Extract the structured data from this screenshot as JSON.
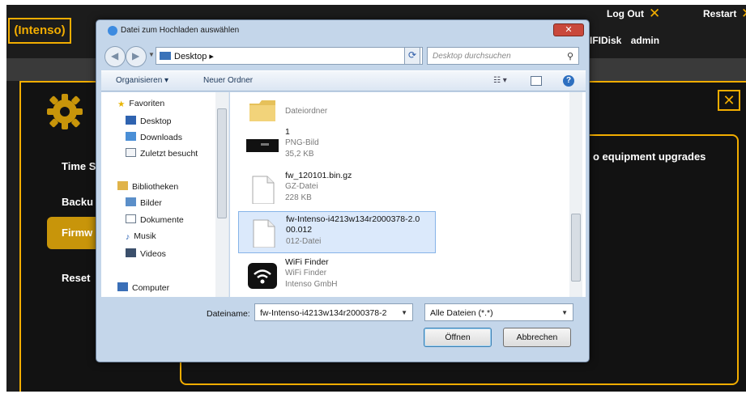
{
  "app": {
    "logo": "(Intenso)",
    "logout": "Log Out",
    "restart": "Restart",
    "device": "IFIDisk",
    "user": "admin",
    "menu": [
      "Time S",
      "Backu",
      "Firmw",
      "Reset"
    ],
    "content_text": "o equipment upgrades",
    "accent_color": "#f2ad00"
  },
  "dialog": {
    "title": "Datei zum Hochladen auswählen",
    "close_glyph": "✕",
    "address": "Desktop",
    "address_arrow": "▸",
    "search_placeholder": "Desktop durchsuchen",
    "toolbar": {
      "organize": "Organisieren ▾",
      "new_folder": "Neuer Ordner",
      "view_glyph": "☷ ▾",
      "help_glyph": "?"
    },
    "nav_items": [
      {
        "label": "Favoriten",
        "icon": "star-icon"
      },
      {
        "label": "Desktop",
        "icon": "desktop-icon"
      },
      {
        "label": "Downloads",
        "icon": "downloads-icon"
      },
      {
        "label": "Zuletzt besucht",
        "icon": "recent-icon"
      },
      {
        "label": "Bibliotheken",
        "icon": "library-icon"
      },
      {
        "label": "Bilder",
        "icon": "pictures-icon"
      },
      {
        "label": "Dokumente",
        "icon": "documents-icon"
      },
      {
        "label": "Musik",
        "icon": "music-icon"
      },
      {
        "label": "Videos",
        "icon": "videos-icon"
      },
      {
        "label": "Computer",
        "icon": "computer-icon"
      }
    ],
    "files": [
      {
        "name": "",
        "type": "Dateiordner",
        "size": ""
      },
      {
        "name": "1",
        "type": "PNG-Bild",
        "size": "35,2 KB"
      },
      {
        "name": "fw_120101.bin.gz",
        "type": "GZ-Datei",
        "size": "228 KB"
      },
      {
        "name": "fw-Intenso-i4213w134r2000378-2.0",
        "name2": "00.012",
        "type": "012-Datei",
        "size": ""
      },
      {
        "name": "WiFi Finder",
        "type": "WiFi Finder",
        "size": "Intenso GmbH"
      }
    ],
    "filename_label": "Dateiname:",
    "filename_value": "fw-Intenso-i4213w134r2000378-2",
    "filetype_value": "Alle Dateien (*.*)",
    "open_button": "Öffnen",
    "cancel_button": "Abbrechen"
  }
}
